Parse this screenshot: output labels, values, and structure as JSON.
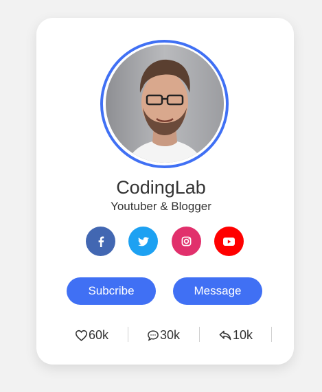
{
  "profile": {
    "name": "CodingLab",
    "job": "Youtuber & Blogger"
  },
  "social_links": [
    {
      "icon": "facebook-icon",
      "color": "#4267b2"
    },
    {
      "icon": "twitter-icon",
      "color": "#1da1f2"
    },
    {
      "icon": "instagram-icon",
      "color": "#e1306c"
    },
    {
      "icon": "youtube-icon",
      "color": "#ff0000"
    }
  ],
  "buttons": {
    "subscribe": "Subcribe",
    "message": "Message"
  },
  "stats": {
    "likes": "60k",
    "comments": "30k",
    "shares": "10k"
  },
  "colors": {
    "accent": "#4070f4",
    "background": "#f2f2f2",
    "card": "#ffffff"
  }
}
